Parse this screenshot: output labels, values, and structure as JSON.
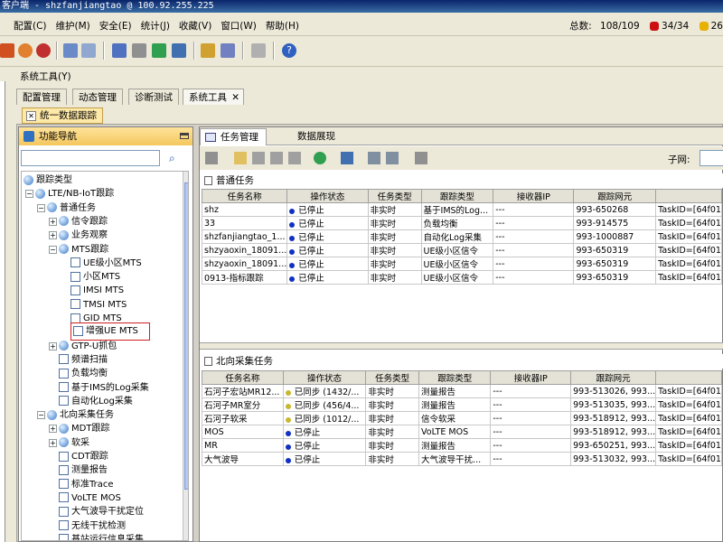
{
  "window": {
    "title": "客户端 - shzfanjiangtao @ 100.92.255.225"
  },
  "menu": [
    "配置(C)",
    "维护(M)",
    "安全(E)",
    "统计(J)",
    "收藏(V)",
    "窗口(W)",
    "帮助(H)"
  ],
  "stats": {
    "total_label": "总数:",
    "total_value": "108/109",
    "red_value": "34/34",
    "yellow_value": "26"
  },
  "colors": {
    "red": "#cc1010",
    "yellow": "#e8b000",
    "title": "#0a246a",
    "stopped": "#1030c0",
    "synced": "#c8b830"
  },
  "system_tool_label": "系统工具(Y)",
  "main_tabs": [
    "配置管理",
    "动态管理",
    "诊断测试",
    "系统工具"
  ],
  "sub_tab": "统一数据跟踪",
  "nav": {
    "title": "功能导航",
    "tree": [
      {
        "label": "跟踪类型",
        "level": 0
      },
      {
        "label": "LTE/NB-IoT跟踪",
        "level": 1
      },
      {
        "label": "普通任务",
        "level": 2
      },
      {
        "label": "信令跟踪",
        "level": 3
      },
      {
        "label": "业务观察",
        "level": 3
      },
      {
        "label": "MTS跟踪",
        "level": 3
      },
      {
        "label": "UE级小区MTS",
        "level": 4
      },
      {
        "label": "小区MTS",
        "level": 4
      },
      {
        "label": "IMSI MTS",
        "level": 4
      },
      {
        "label": "TMSI MTS",
        "level": 4
      },
      {
        "label": "GID MTS",
        "level": 4
      },
      {
        "label": "增强UE MTS",
        "level": 4
      },
      {
        "label": "GTP-U抓包",
        "level": 3
      },
      {
        "label": "频谱扫描",
        "level": 3
      },
      {
        "label": "负载均衡",
        "level": 3
      },
      {
        "label": "基于IMS的Log采集",
        "level": 3
      },
      {
        "label": "自动化Log采集",
        "level": 3
      },
      {
        "label": "北向采集任务",
        "level": 2
      },
      {
        "label": "MDT跟踪",
        "level": 3
      },
      {
        "label": "软采",
        "level": 3
      },
      {
        "label": "CDT跟踪",
        "level": 3
      },
      {
        "label": "测量报告",
        "level": 3
      },
      {
        "label": "标准Trace",
        "level": 3
      },
      {
        "label": "VoLTE MOS",
        "level": 3
      },
      {
        "label": "大气波导干扰定位",
        "level": 3
      },
      {
        "label": "无线干扰检测",
        "level": 3
      },
      {
        "label": "基站运行信息采集",
        "level": 3
      }
    ]
  },
  "right_tabs": [
    "任务管理",
    "数据展现"
  ],
  "subnet_label": "子网:",
  "normal_tasks": {
    "title": "普通任务",
    "columns": [
      "任务名称",
      "操作状态",
      "任务类型",
      "跟踪类型",
      "接收器IP",
      "跟踪网元",
      ""
    ],
    "rows": [
      [
        "shz",
        "已停止",
        "非实时",
        "基于IMS的Log...",
        "---",
        "993-650268",
        "TaskID=[64f01"
      ],
      [
        "33",
        "已停止",
        "非实时",
        "负载均衡",
        "---",
        "993-914575",
        "TaskID=[64f01"
      ],
      [
        "shzfanjiangtao_1...",
        "已停止",
        "非实时",
        "自动化Log采集",
        "---",
        "993-1000887",
        "TaskID=[64f01"
      ],
      [
        "shzyaoxin_18091...",
        "已停止",
        "非实时",
        "UE级小区信令",
        "---",
        "993-650319",
        "TaskID=[64f01"
      ],
      [
        "shzyaoxin_18091...",
        "已停止",
        "非实时",
        "UE级小区信令",
        "---",
        "993-650319",
        "TaskID=[64f01"
      ],
      [
        "0913-指标跟踪",
        "已停止",
        "非实时",
        "UE级小区信令",
        "---",
        "993-650319",
        "TaskID=[64f01"
      ]
    ]
  },
  "north_tasks": {
    "title": "北向采集任务",
    "columns": [
      "任务名称",
      "操作状态",
      "任务类型",
      "跟踪类型",
      "接收器IP",
      "跟踪网元",
      ""
    ],
    "rows": [
      [
        "石河子宏站MR12...",
        "已同步 (1432/...",
        "非实时",
        "测量报告",
        "---",
        "993-513026, 993...",
        "TaskID=[64f01"
      ],
      [
        "石河子MR室分",
        "已同步 (456/4...",
        "非实时",
        "测量报告",
        "---",
        "993-513035, 993...",
        "TaskID=[64f01"
      ],
      [
        "石河子软采",
        "已同步 (1012/...",
        "非实时",
        "信令软采",
        "---",
        "993-518912, 993...",
        "TaskID=[64f01"
      ],
      [
        "MOS",
        "已停止",
        "非实时",
        "VoLTE MOS",
        "---",
        "993-518912, 993...",
        "TaskID=[64f01"
      ],
      [
        "MR",
        "已停止",
        "非实时",
        "测量报告",
        "---",
        "993-650251, 993...",
        "TaskID=[64f01"
      ],
      [
        "大气波导",
        "已停止",
        "非实时",
        "大气波导干扰...",
        "---",
        "993-513032, 993...",
        "TaskID=[64f01"
      ]
    ]
  }
}
